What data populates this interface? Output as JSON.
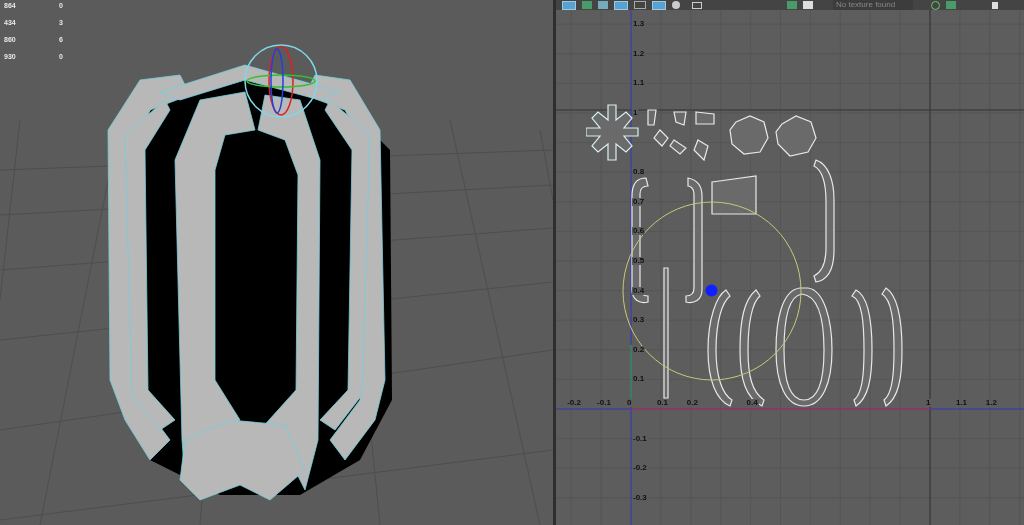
{
  "stats": [
    {
      "value": "864",
      "count": "0"
    },
    {
      "value": "434",
      "count": "3"
    },
    {
      "value": "860",
      "count": "6"
    },
    {
      "value": "930",
      "count": "0"
    }
  ],
  "uv_editor": {
    "toolbar": {
      "texture_status": "No texture found"
    },
    "u_ticks": [
      "-0.2",
      "-0.1",
      "0",
      "0.1",
      "0.2",
      "0.4",
      "1",
      "1.1",
      "1.2"
    ],
    "v_ticks": [
      "1.3",
      "1.2",
      "1.1",
      "1",
      "0.8",
      "0.7",
      "0.6",
      "0.5",
      "0.4",
      "0.3",
      "0.2",
      "0.1",
      "-0.1",
      "-0.2",
      "-0.3"
    ]
  }
}
